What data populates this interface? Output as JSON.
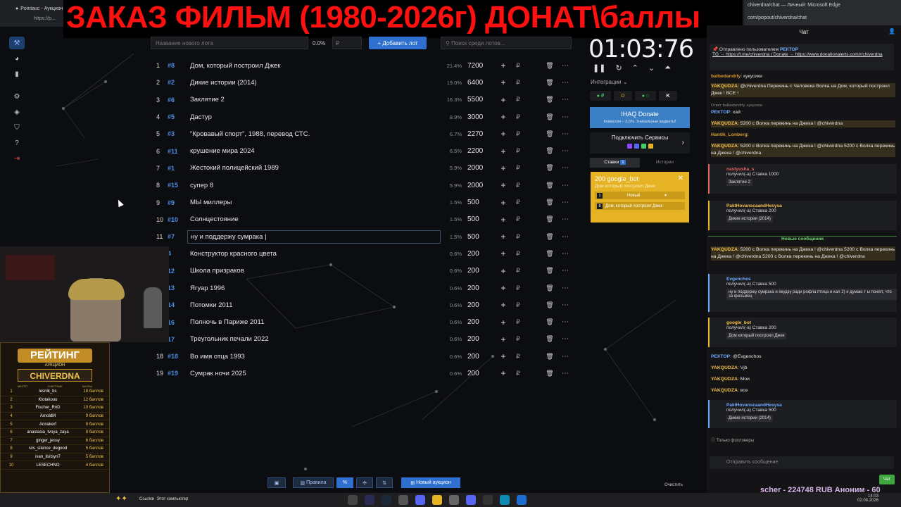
{
  "browser": {
    "tab_title": "Pointauc - Аукцион",
    "url": "https://p...",
    "right_title": "chiverdna/chat — Личный: Microsoft Edge",
    "right_url": "com/popout/chiverdna/chat"
  },
  "overlay_title": "ЗАКАЗ ФИЛЬМ (1980-2026г) ДОНАТ\\баллы",
  "lot_input": {
    "name_placeholder": "Название нового лота",
    "percent": "0.0%",
    "amount_placeholder": "₽",
    "add_label": "Добавить лот",
    "search_placeholder": "Поиск среди лотов..."
  },
  "lots": [
    {
      "num": "1",
      "id": "#8",
      "name": "Дом, который построил Джек",
      "perc": "21.4%",
      "amount": "7200"
    },
    {
      "num": "2",
      "id": "#2",
      "name": "Дикие истории (2014)",
      "perc": "19.0%",
      "amount": "6400"
    },
    {
      "num": "3",
      "id": "#6",
      "name": "Заклятие 2",
      "perc": "16.3%",
      "amount": "5500"
    },
    {
      "num": "4",
      "id": "#5",
      "name": "Дастур",
      "perc": "8.9%",
      "amount": "3000"
    },
    {
      "num": "5",
      "id": "#3",
      "name": "\"Кровавый спорт\", 1988, перевод СТС.",
      "perc": "6.7%",
      "amount": "2270"
    },
    {
      "num": "6",
      "id": "#11",
      "name": "крушение мира 2024",
      "perc": "6.5%",
      "amount": "2200"
    },
    {
      "num": "7",
      "id": "#1",
      "name": "Жестокий полицейский 1989",
      "perc": "5.9%",
      "amount": "2000"
    },
    {
      "num": "8",
      "id": "#15",
      "name": "супер 8",
      "perc": "5.9%",
      "amount": "2000"
    },
    {
      "num": "9",
      "id": "#9",
      "name": "МЫ миллеры",
      "perc": "1.5%",
      "amount": "500"
    },
    {
      "num": "10",
      "id": "#10",
      "name": "Солнцестояние",
      "perc": "1.5%",
      "amount": "500"
    },
    {
      "num": "11",
      "id": "#7",
      "name": "ну и поддержу сумрака |",
      "perc": "1.5%",
      "amount": "500"
    },
    {
      "num": "",
      "id": "4",
      "name": "Конструктор красного цвета",
      "perc": "0.6%",
      "amount": "200"
    },
    {
      "num": "",
      "id": "12",
      "name": "Школа призраков",
      "perc": "0.6%",
      "amount": "200"
    },
    {
      "num": "",
      "id": "13",
      "name": "Ягуар 1996",
      "perc": "0.6%",
      "amount": "200"
    },
    {
      "num": "",
      "id": "14",
      "name": "Потомки 2011",
      "perc": "0.6%",
      "amount": "200"
    },
    {
      "num": "",
      "id": "16",
      "name": "Полночь в Париже 2011",
      "perc": "0.6%",
      "amount": "200"
    },
    {
      "num": "",
      "id": "17",
      "name": "Треугольник печали 2022",
      "perc": "0.6%",
      "amount": "200"
    },
    {
      "num": "18",
      "id": "#18",
      "name": "Во имя отца 1993",
      "perc": "0.6%",
      "amount": "200"
    },
    {
      "num": "19",
      "id": "#19",
      "name": "Сумрак ночи 2025",
      "perc": "0.6%",
      "amount": "200"
    }
  ],
  "timer": {
    "value": "01:03:76",
    "integrations_label": "Интеграции",
    "ihaq_title": "IHAQ Donate",
    "ihaq_sub": "Комиссия – 3,5%. Уникальные виджеты!",
    "services_label": "Подключить Сервисы",
    "tab_bets": "Ставки",
    "tab_bets_count": "1",
    "tab_history": "Истории"
  },
  "bet_card": {
    "title": "200 google_bot",
    "sub": "Дом который построил Джек",
    "row1_badge": "1",
    "row1_label": "Новый",
    "row2_badge": "8",
    "row2_label": "Дом, который построил Джек"
  },
  "bottom_bar": {
    "rules_label": "Правила",
    "new_auction_label": "Новый аукцион",
    "clear_label": "Очистить"
  },
  "rating": {
    "title": "РЕЙТИНГ",
    "subtitle": "АУКЦИОН",
    "brand": "CHIVERDNA",
    "col_place": "МЕСТО",
    "col_user": "УЧАСТНИК",
    "col_score": "БАЛЛЫ",
    "rows": [
      {
        "place": "1",
        "name": "lesnik_bs",
        "score": "18 баллов"
      },
      {
        "place": "2",
        "name": "Ktotakouu",
        "score": "12 баллов"
      },
      {
        "place": "3",
        "name": "Fischer_RnD",
        "score": "10 баллов"
      },
      {
        "place": "4",
        "name": "ArnoldM",
        "score": "9 баллов"
      },
      {
        "place": "5",
        "name": "Annakerf",
        "score": "8 баллов"
      },
      {
        "place": "6",
        "name": "anastasia_tvoya_zaya",
        "score": "8 баллов"
      },
      {
        "place": "7",
        "name": "ginger_jessy",
        "score": "6 баллов"
      },
      {
        "place": "8",
        "name": "svs_silence_degood",
        "score": "5 баллов"
      },
      {
        "place": "9",
        "name": "ivan_lisitsyn7",
        "score": "5 баллов"
      },
      {
        "place": "10",
        "name": "LESECHNO",
        "score": "4 баллов"
      }
    ]
  },
  "chat": {
    "header": "Чат",
    "pinned_from": "Отправлено пользователем",
    "pinned_user": "РЕКТОР",
    "pinned_text": "TG → https://t.me/chiverdna | Donate → https://www.donationalerts.com/r/chiverdna",
    "m1_user": "balbedandrly",
    "m1_text": ": кукусики",
    "m2_user": "YAKQUDZA",
    "m2_text": ": @chiverdna Перекинь с Человека Волка на Дом, который построил Джек ! ВСЕ !",
    "m3_reply": "Ответ balbedandrly: кукусики",
    "m3_user": "РЕКТОР",
    "m3_text": ": хай",
    "m4_user": "YAKQUDZA",
    "m4_text": ": 5200 с Волка перекинь на Джека ! @chiverdna",
    "m5_user": "Hantik_Lonberg",
    "m5_text": ":",
    "m6_user": "YAKQUDZA",
    "m6_text": ": 5200 с Волка перекинь на Джека ! @chiverdna 5200 с Волка перекинь на Джека ! @chiverdna",
    "e1_user": "nastyusha_s",
    "e1_action": "получил(-а) Ставка 1000",
    "e1_box": "Заклятие 2",
    "e2_user": "PaktHovanscaandHesysa",
    "e2_action": "получил(-а) Ставка 200",
    "e2_box": "Дикие истории (2014)",
    "new_messages": "Новые сообщения",
    "m7_user": "YAKQUDZA",
    "m7_text": ": 5200 с Волка перекинь на Джека ! @chiverdna 5200 с Волка перекинь на Джека ! @chiverdna 5200 с Волка перекинь на Джека ! @chiverdna",
    "e3_user": "Evgenchos",
    "e3_action": "получил(-а) Ставка 500",
    "e3_box": "ну и поддержу сумрака и якудзу ради рофла птица и кал 2) я думаю т ы понял, что за фильмец",
    "e4_user": "google_bot",
    "e4_action": "получил(-а) Ставка 200",
    "e4_box": "Дом который построил Джек",
    "m8_user": "РЕКТОР",
    "m8_text": ": @Evgenchos",
    "m9_user": "YAKQUDZA",
    "m9_text": ": Vjb",
    "m10_user": "YAKQUDZA",
    "m10_text": ": Мои",
    "m11_user": "YAKQUDZA",
    "m11_text": ": все",
    "e5_user": "PaktHovanscaandHesysa",
    "e5_action": "получил(-а) Ставка 500",
    "e5_box": "Дикие истории (2014)",
    "followers_only": "Только фолловеры",
    "input_placeholder": "Отправить сообщение",
    "chat_button": "Чат"
  },
  "donors_ticker": "scher - 224748 RUB   Аноним - 60",
  "taskbar": {
    "links_label": "Ссылки",
    "computer_label": "Этот компьютер",
    "time": "14:03",
    "date": "02.08.2026"
  }
}
